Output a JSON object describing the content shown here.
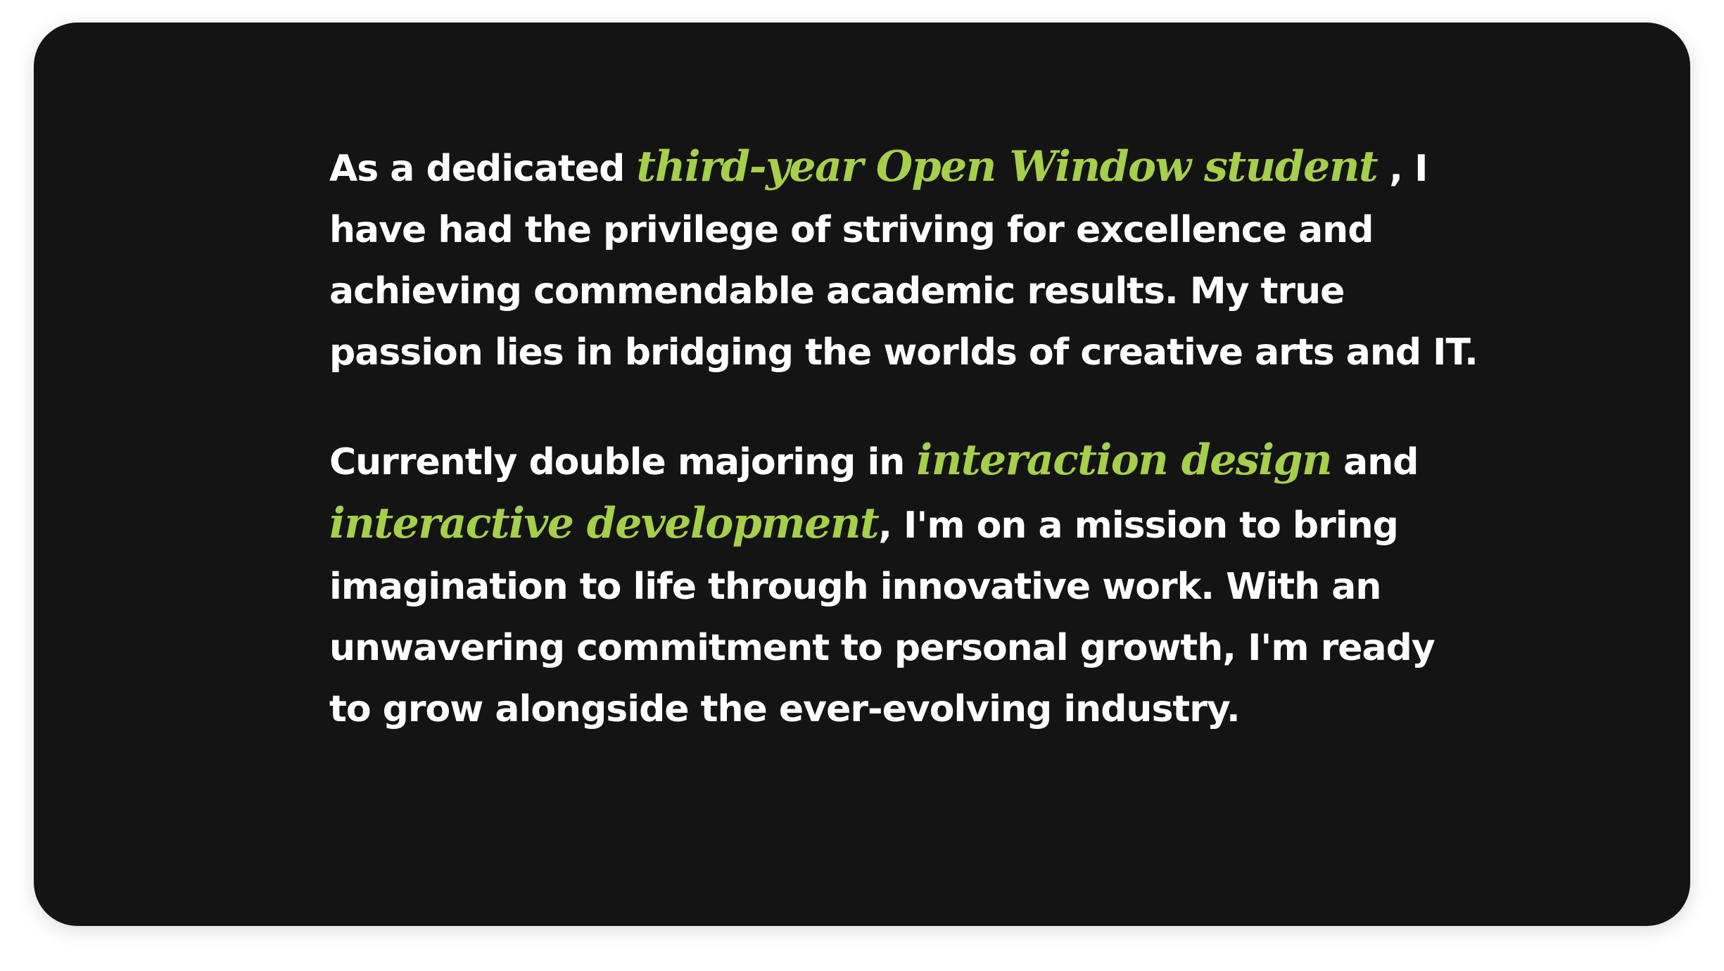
{
  "colors": {
    "page_background": "#ffffff",
    "card_background": "#141414",
    "text": "#ffffff",
    "highlight": "#a6cf4a"
  },
  "about": {
    "paragraph1": {
      "lead": "As a dedicated ",
      "highlight": "third-year Open Window student",
      "rest": " , I have had the privilege of striving for excellence and achieving commendable academic results. My true passion lies in bridging the worlds of creative arts and IT."
    },
    "paragraph2": {
      "lead": "Currently double majoring in ",
      "highlight1": "interaction design",
      "middle": " and ",
      "highlight2": "interactive development",
      "rest": ", I'm on a mission to bring imagination to life through innovative work. With an unwavering commitment to personal growth, I'm ready to grow alongside the ever-evolving industry."
    }
  }
}
